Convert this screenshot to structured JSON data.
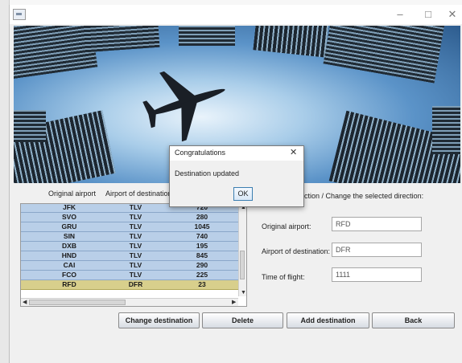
{
  "window": {
    "title": ""
  },
  "table": {
    "columns": [
      "Original airport",
      "Airport of destination"
    ],
    "rows": [
      {
        "origin": "JFK",
        "destination": "TLV",
        "time": "720"
      },
      {
        "origin": "SVO",
        "destination": "TLV",
        "time": "280"
      },
      {
        "origin": "GRU",
        "destination": "TLV",
        "time": "1045"
      },
      {
        "origin": "SIN",
        "destination": "TLV",
        "time": "740"
      },
      {
        "origin": "DXB",
        "destination": "TLV",
        "time": "195"
      },
      {
        "origin": "HND",
        "destination": "TLV",
        "time": "845"
      },
      {
        "origin": "CAI",
        "destination": "TLV",
        "time": "290"
      },
      {
        "origin": "FCO",
        "destination": "TLV",
        "time": "225"
      },
      {
        "origin": "RFD",
        "destination": "DFR",
        "time": "23"
      }
    ],
    "selected_index": 8
  },
  "form": {
    "header": "rection / Change the selected direction:",
    "original_label": "Original airport:",
    "original_value": "RFD",
    "destination_label": "Airport of destination:",
    "destination_value": "DFR",
    "time_label": "Time of flight:",
    "time_value": "1111"
  },
  "buttons": {
    "change": "Change destination",
    "delete": "Delete",
    "add": "Add destination",
    "back": "Back"
  },
  "dialog": {
    "title": "Congratulations",
    "message": "Destination updated",
    "ok": "OK"
  },
  "icons": {
    "app": "app-icon",
    "minimize": "minimize-icon",
    "maximize": "maximize-icon",
    "close": "close-icon",
    "dialog_close": "close-icon"
  }
}
